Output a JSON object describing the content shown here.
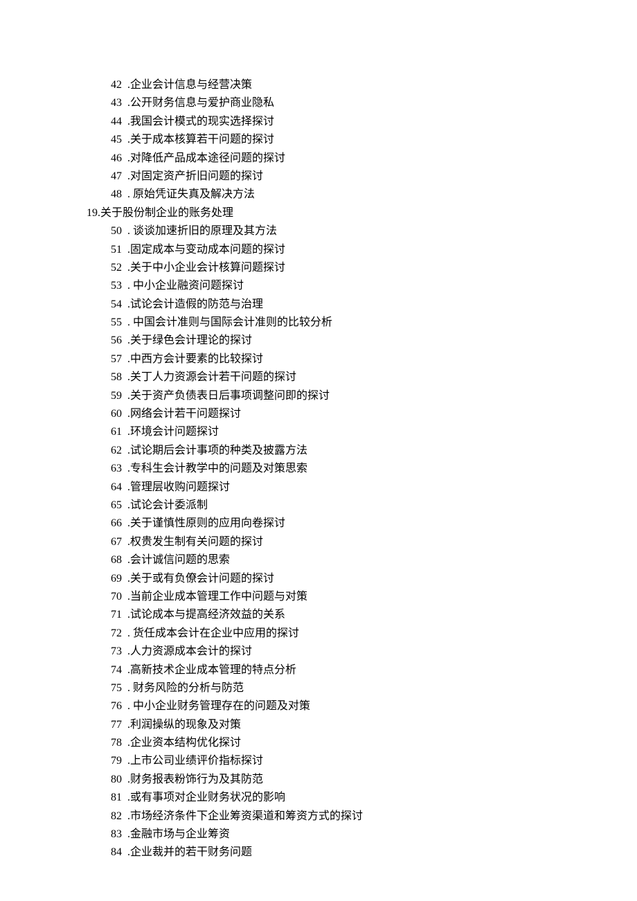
{
  "items": [
    {
      "n": "42",
      "sep": "  .",
      "t": "企业会计信息与经营决策",
      "indent": true
    },
    {
      "n": "43",
      "sep": "  .",
      "t": "公开财务信息与爱护商业隐私",
      "indent": true
    },
    {
      "n": "44",
      "sep": "  .",
      "t": "我国会计模式的现实选择探讨",
      "indent": true
    },
    {
      "n": "45",
      "sep": "  .",
      "t": "关于成本核算若干问题的探讨",
      "indent": true
    },
    {
      "n": "46",
      "sep": "  .",
      "t": "对降低产品成本途径问题的探讨",
      "indent": true
    },
    {
      "n": "47",
      "sep": "  .",
      "t": "对固定资产折旧问题的探讨",
      "indent": true
    },
    {
      "n": "48",
      "sep": "  . ",
      "t": "原始凭证失真及解决方法",
      "indent": true
    },
    {
      "n": "19.",
      "sep": "",
      "t": "关于股份制企业的账务处理",
      "indent": false
    },
    {
      "n": "50",
      "sep": "  . ",
      "t": "谈谈加速折旧的原理及其方法",
      "indent": true
    },
    {
      "n": "51",
      "sep": "  .",
      "t": "固定成本与变动成本问题的探讨",
      "indent": true
    },
    {
      "n": "52",
      "sep": "  .",
      "t": "关于中小企业会计核算问题探讨",
      "indent": true
    },
    {
      "n": "53",
      "sep": "  . ",
      "t": "中小企业融资问题探讨",
      "indent": true
    },
    {
      "n": "54",
      "sep": "  .",
      "t": "试论会计造假的防范与治理",
      "indent": true
    },
    {
      "n": "55",
      "sep": "  . ",
      "t": "中国会计准则与国际会计准则的比较分析",
      "indent": true
    },
    {
      "n": "56",
      "sep": "  .",
      "t": "关于绿色会计理论的探讨",
      "indent": true
    },
    {
      "n": "57",
      "sep": "  .",
      "t": "中西方会计要素的比较探讨",
      "indent": true
    },
    {
      "n": "58",
      "sep": "  .",
      "t": "关丁人力资源会计若干问题的探讨",
      "indent": true
    },
    {
      "n": "59",
      "sep": "  .",
      "t": "关于资产负债表日后事项调整问即的探讨",
      "indent": true
    },
    {
      "n": "60",
      "sep": "  .",
      "t": "网络会计若干问题探讨",
      "indent": true
    },
    {
      "n": "61",
      "sep": "  .",
      "t": "环境会计问题探讨",
      "indent": true
    },
    {
      "n": "62",
      "sep": "  .",
      "t": "试论期后会计事项的种类及披露方法",
      "indent": true
    },
    {
      "n": "63",
      "sep": "  .",
      "t": "专科生会计教学中的问题及对策思索",
      "indent": true
    },
    {
      "n": "64",
      "sep": "  .",
      "t": "管理层收购问题探讨",
      "indent": true
    },
    {
      "n": "65",
      "sep": "  .",
      "t": "试论会计委派制",
      "indent": true
    },
    {
      "n": "66",
      "sep": "  .",
      "t": "关于谨慎性原则的应用向卷探讨",
      "indent": true
    },
    {
      "n": "67",
      "sep": "  .",
      "t": "权贵发生制有关问题的探讨",
      "indent": true
    },
    {
      "n": "68",
      "sep": "  .",
      "t": "会计诚信问题的思索",
      "indent": true
    },
    {
      "n": "69",
      "sep": "  .",
      "t": "关于或有负僚会计问题的探讨",
      "indent": true
    },
    {
      "n": "70",
      "sep": "  .",
      "t": "当前企业成本管理工作中问题与对策",
      "indent": true
    },
    {
      "n": "71",
      "sep": "  .",
      "t": "试论成本与提高经济效益的关系",
      "indent": true
    },
    {
      "n": "72",
      "sep": "  . ",
      "t": "货任成本会计在企业中应用的探讨",
      "indent": true
    },
    {
      "n": "73",
      "sep": "  .",
      "t": "人力资源成本会计的探讨",
      "indent": true
    },
    {
      "n": "74",
      "sep": "  .",
      "t": "高新技术企业成本管理的特点分析",
      "indent": true
    },
    {
      "n": "75",
      "sep": "  . ",
      "t": "财务风险的分析与防范",
      "indent": true
    },
    {
      "n": "76",
      "sep": "  . ",
      "t": "中小企业财务管理存在的问题及对策",
      "indent": true
    },
    {
      "n": "77",
      "sep": "  .",
      "t": "利润操纵的现象及对策",
      "indent": true
    },
    {
      "n": "78",
      "sep": "  .",
      "t": "企业资本结构优化探讨",
      "indent": true
    },
    {
      "n": "79",
      "sep": "  .",
      "t": "上市公司业绩评价指标探讨",
      "indent": true
    },
    {
      "n": "80",
      "sep": "  .",
      "t": "财务报表粉饰行为及其防范",
      "indent": true
    },
    {
      "n": "81",
      "sep": "  .",
      "t": "或有事项对企业财务状况的影响",
      "indent": true
    },
    {
      "n": "82",
      "sep": "  .",
      "t": "市场经济条件下企业筹资渠道和筹资方式的探讨",
      "indent": true
    },
    {
      "n": "83",
      "sep": "  .",
      "t": "金融市场与企业筹资",
      "indent": true
    },
    {
      "n": "84",
      "sep": "  .",
      "t": "企业裁并的若干财务问题",
      "indent": true
    }
  ]
}
